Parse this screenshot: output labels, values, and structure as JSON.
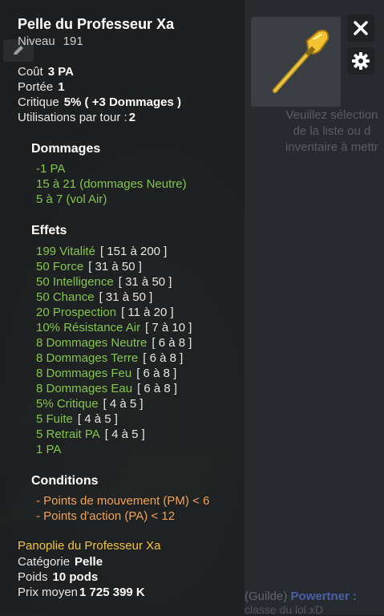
{
  "item": {
    "name": "Pelle du Professeur Xa",
    "level_label": "Niveau",
    "level_value": "191"
  },
  "stats": [
    {
      "label": "Coût",
      "value": "3 PA"
    },
    {
      "label": "Portée",
      "value": "1"
    },
    {
      "label": "Critique",
      "value": "5% ( +3 Dommages )"
    },
    {
      "label": "Utilisations par tour :",
      "value": "2"
    }
  ],
  "damages": {
    "title": "Dommages",
    "lines": [
      "-1 PA",
      "15 à 21 (dommages Neutre)",
      "5 à 7 (vol Air)"
    ]
  },
  "effects": {
    "title": "Effets",
    "lines": [
      {
        "text": "199 Vitalité",
        "range": "[ 151 à 200 ]"
      },
      {
        "text": "50 Force",
        "range": "[ 31 à 50 ]"
      },
      {
        "text": "50 Intelligence",
        "range": "[ 31 à 50 ]"
      },
      {
        "text": "50 Chance",
        "range": "[ 31 à 50 ]"
      },
      {
        "text": "20 Prospection",
        "range": "[ 11 à 20 ]"
      },
      {
        "text": "10% Résistance Air",
        "range": "[ 7 à 10 ]"
      },
      {
        "text": "8 Dommages Neutre",
        "range": "[ 6 à 8 ]"
      },
      {
        "text": "8 Dommages Terre",
        "range": "[ 6 à 8 ]"
      },
      {
        "text": "8 Dommages Feu",
        "range": "[ 6 à 8 ]"
      },
      {
        "text": "8 Dommages Eau",
        "range": "[ 6 à 8 ]"
      },
      {
        "text": "5% Critique",
        "range": "[ 4 à 5 ]"
      },
      {
        "text": "5 Fuite",
        "range": "[ 4 à 5 ]"
      },
      {
        "text": "5 Retrait PA",
        "range": "[ 4 à 5 ]"
      },
      {
        "text": "1 PA",
        "range": ""
      }
    ]
  },
  "conditions": {
    "title": "Conditions",
    "lines": [
      "- Points de mouvement (PM) < 6",
      "- Points d'action (PA) < 12"
    ]
  },
  "set": {
    "name": "Panoplie du Professeur Xa"
  },
  "footer": [
    {
      "label": "Catégorie",
      "value": "Pelle"
    },
    {
      "label": "Poids",
      "value": "10 pods"
    },
    {
      "label": "Prix moyen",
      "value": "1 725 399 K"
    }
  ],
  "right_panel": {
    "hint_lines": [
      "Veuillez sélection",
      "de la liste ou d",
      "inventaire à mettr"
    ],
    "chat_prefix": "(Guilde)",
    "chat_name": "Powertner :",
    "chat_line2": "classe du lol xD"
  },
  "icons": {
    "close": "close-icon",
    "settings": "gear-icon",
    "item": "shovel-icon"
  },
  "colors": {
    "effect_green": "#84c64c",
    "condition_orange": "#f1a35a",
    "set_gold": "#f0c43a"
  }
}
